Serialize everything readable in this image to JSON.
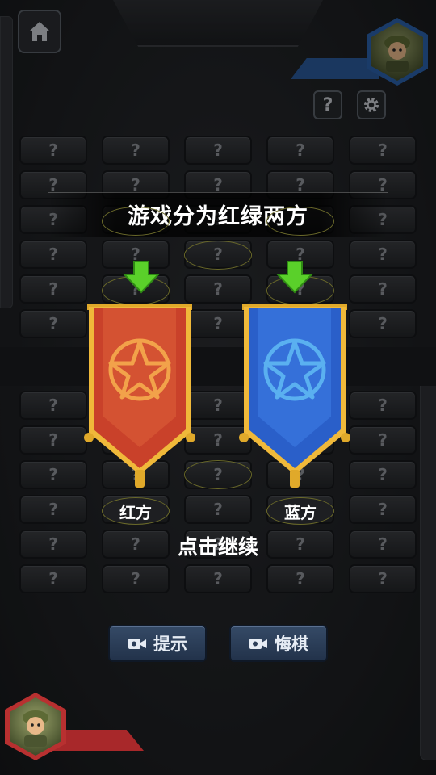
{
  "grid": {
    "cell_symbol": "?",
    "rows": 13,
    "cols": 5
  },
  "overlay": {
    "title": "游戏分为红绿两方",
    "red_label": "红方",
    "blue_label": "蓝方",
    "continue_text": "点击继续"
  },
  "buttons": {
    "help_label": "?",
    "hint_label": "提示",
    "undo_label": "悔棋"
  },
  "colors": {
    "red_banner": "#c9412a",
    "blue_banner": "#2a5fc9",
    "arrow_green": "#5ad02a",
    "action_button": "#2c3e58"
  },
  "icons": {
    "home": "home-icon",
    "settings": "gear-icon",
    "camera": "video-camera-icon"
  }
}
